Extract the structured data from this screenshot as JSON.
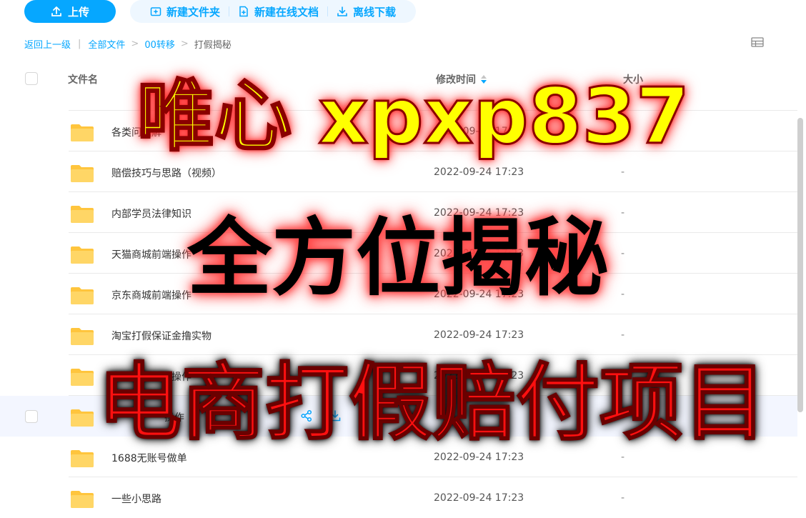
{
  "toolbar": {
    "upload": "上传",
    "new_folder": "新建文件夹",
    "new_online_doc": "新建在线文档",
    "offline_download": "离线下载"
  },
  "breadcrumb": {
    "back": "返回上一级",
    "separator": "|",
    "items": [
      "全部文件",
      "00转移",
      "打假揭秘"
    ]
  },
  "table_header": {
    "name": "文件名",
    "modified": "修改时间",
    "size": "大小"
  },
  "files": [
    {
      "name": "各类问题解",
      "modified": "2022-09-24 17:23",
      "size": "-"
    },
    {
      "name": "赔偿技巧与思路（视频）",
      "modified": "2022-09-24 17:23",
      "size": "-"
    },
    {
      "name": "内部学员法律知识",
      "modified": "2022-09-24 17:23",
      "size": "-"
    },
    {
      "name": "天猫商城前端操作",
      "modified": "2022-09-24 17:23",
      "size": "-"
    },
    {
      "name": "京东商城前端操作",
      "modified": "2022-09-24 17:23",
      "size": "-"
    },
    {
      "name": "淘宝打假保证金撸实物",
      "modified": "2022-09-24 17:23",
      "size": "-"
    },
    {
      "name": "小众电商前端操作",
      "modified": "2022-09-24 17:23",
      "size": "-"
    },
    {
      "name": "操作",
      "modified": "",
      "size": ""
    },
    {
      "name": "1688无账号做单",
      "modified": "2022-09-24 17:23",
      "size": "-"
    },
    {
      "name": "一些小思路",
      "modified": "2022-09-24 17:23",
      "size": "-"
    }
  ],
  "overlay": {
    "line1": "唯心 xpxp837",
    "line2": "全方位揭秘",
    "line3": "电商打假赔付项目"
  },
  "colors": {
    "accent": "#06a7ff",
    "folder": "#ffc53d",
    "overlay_yellow": "#ffff00",
    "overlay_red": "#ff1010"
  }
}
